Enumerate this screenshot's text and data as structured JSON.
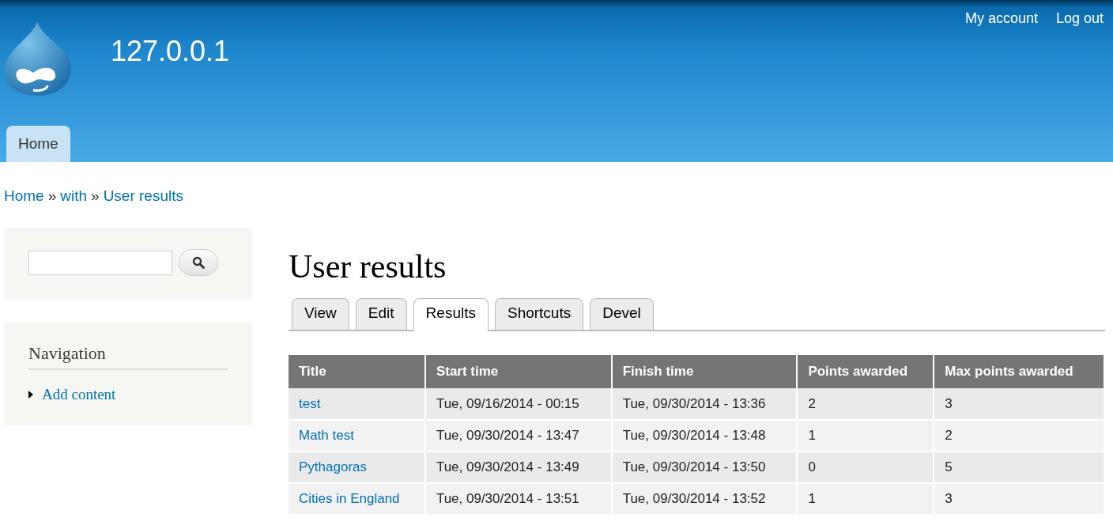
{
  "header": {
    "site_name": "127.0.0.1",
    "user_links": [
      "My account",
      "Log out"
    ],
    "main_menu": [
      {
        "label": "Home",
        "selected": true
      }
    ]
  },
  "breadcrumb": [
    {
      "kind": "link",
      "text": "Home"
    },
    {
      "kind": "separator",
      "text": "»"
    },
    {
      "kind": "link",
      "text": "with"
    },
    {
      "kind": "separator",
      "text": "»"
    },
    {
      "kind": "link",
      "text": "User results"
    }
  ],
  "sidebar": {
    "navigation": {
      "title": "Navigation",
      "items": [
        "Add content"
      ]
    }
  },
  "page_title": "User results",
  "tabs": [
    {
      "label": "View",
      "selected": false
    },
    {
      "label": "Edit",
      "selected": false
    },
    {
      "label": "Results",
      "selected": true
    },
    {
      "label": "Shortcuts",
      "selected": false
    },
    {
      "label": "Devel",
      "selected": false
    }
  ],
  "table": {
    "columns": [
      "Title",
      "Start time",
      "Finish time",
      "Points awarded",
      "Max points awarded"
    ],
    "rows": [
      [
        "test",
        "Tue, 09/16/2014 - 00:15",
        "Tue, 09/30/2014 - 13:36",
        "2",
        "3"
      ],
      [
        "Math test",
        "Tue, 09/30/2014 - 13:47",
        "Tue, 09/30/2014 - 13:48",
        "1",
        "2"
      ],
      [
        "Pythagoras",
        "Tue, 09/30/2014 - 13:49",
        "Tue, 09/30/2014 - 13:50",
        "0",
        "5"
      ],
      [
        "Cities in England",
        "Tue, 09/30/2014 - 13:51",
        "Tue, 09/30/2014 - 13:52",
        "1",
        "3"
      ]
    ]
  }
}
